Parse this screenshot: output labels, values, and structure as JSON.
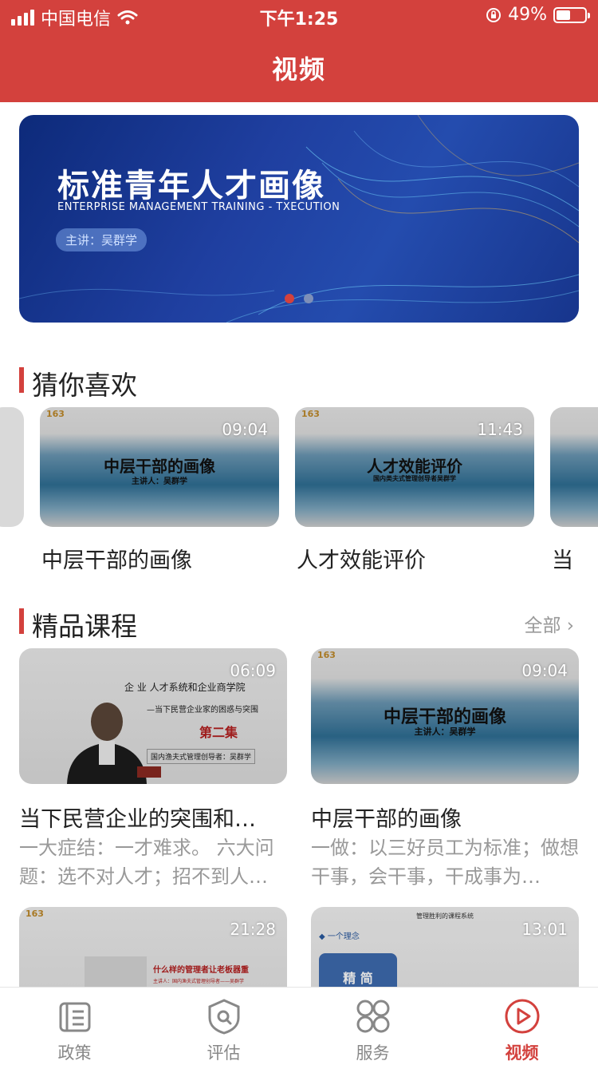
{
  "status_bar": {
    "carrier": "中国电信",
    "time": "下午1:25",
    "battery": "49%"
  },
  "header": {
    "title": "视频"
  },
  "banner": {
    "title": "标准青年人才画像",
    "subtitle": "ENTERPRISE MANAGEMENT TRAINING - TXECUTION",
    "speaker": "主讲：吴群学",
    "active_page": 1,
    "total_pages": 2
  },
  "guess": {
    "title": "猜你喜欢",
    "items": [
      {
        "title": "中层干部的画像",
        "duration": "09:04",
        "thumb_title": "中层干部的画像",
        "thumb_sub": "主讲人：吴群学"
      },
      {
        "title": "人才效能评价",
        "duration": "11:43",
        "thumb_title": "人才效能评价",
        "thumb_sub": "国内类夫式管理创导者吴群学"
      },
      {
        "title": "当"
      }
    ]
  },
  "courses": {
    "title": "精品课程",
    "more": "全部",
    "items": [
      {
        "title": "当下民营企业的突围和…",
        "duration": "06:09",
        "desc": "一大症结：一才难求。 六大问题：选不对人才；招不到人…",
        "thumb_lines": [
          "企 业 人才系统和企业商学院",
          "—当下民营企业家的困惑与突围",
          "第二集",
          "国内渔夫式管理创导者：吴群学"
        ]
      },
      {
        "title": "中层干部的画像",
        "duration": "09:04",
        "desc": "一做：以三好员工为标准；做想干事，会干事，干成事为…",
        "thumb_title": "中层干部的画像",
        "thumb_sub": "主讲人：吴群学"
      },
      {
        "duration": "21:28",
        "thumb_title": "什么样的管理者让老板器重",
        "thumb_sub": "主讲人：国内渔夫式管理创导者——吴群学"
      },
      {
        "duration": "13:01",
        "thumb_head": "管理胜利的课程系统",
        "thumb_item": "一个理念",
        "thumb_box": "精 简"
      }
    ]
  },
  "tabbar": {
    "tabs": [
      {
        "label": "政策",
        "icon": "document-icon"
      },
      {
        "label": "评估",
        "icon": "shield-search-icon"
      },
      {
        "label": "服务",
        "icon": "grid-icon"
      },
      {
        "label": "视频",
        "icon": "play-circle-icon"
      }
    ],
    "active": 3
  },
  "colors": {
    "brand": "#d3413d",
    "muted": "#999999"
  }
}
